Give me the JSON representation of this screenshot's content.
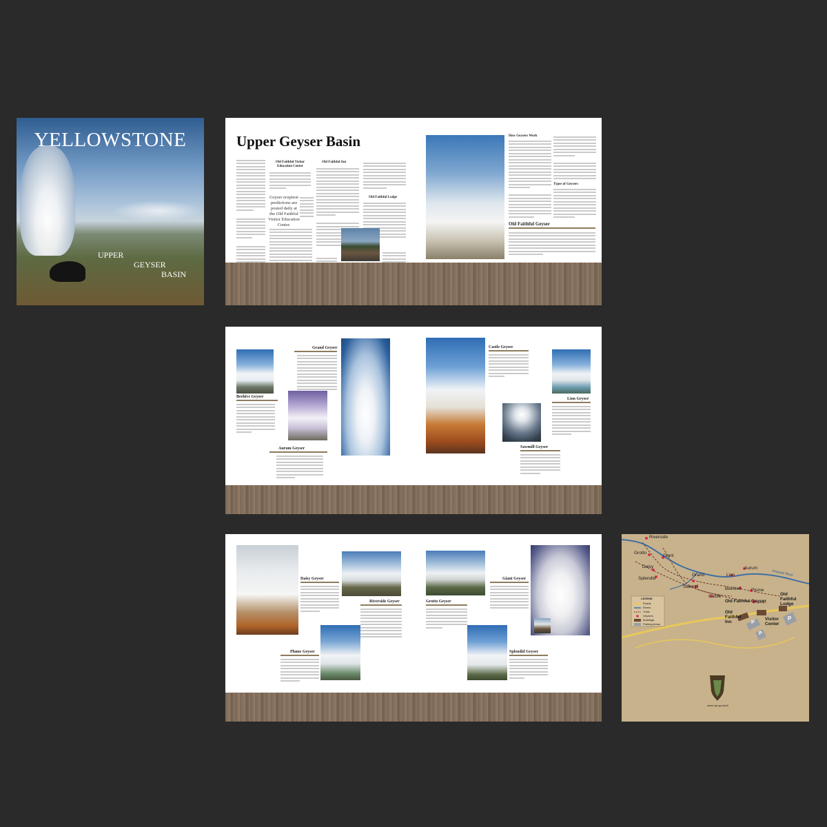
{
  "cover": {
    "title": "YELLOWSTONE",
    "subtitle_lines": [
      "UPPER",
      "GEYSER",
      "BASIN"
    ]
  },
  "page1": {
    "title": "Upper Geyser Basin",
    "headings": {
      "visitor_center": "Old Faithful Visitor Education Center",
      "inn": "Old Faithful Inn",
      "lodge": "Old Faithful Lodge",
      "how_geysers_work": "How Geysers Work",
      "types_of_geysers": "Types of Geysers",
      "old_faithful": "Old Faithful Geyser"
    },
    "pull_quote": "Geyser eruption predictions are posted daily at the Old Faithful Visitor Education Center."
  },
  "page2": {
    "geysers": {
      "grand": "Grand Geyser",
      "beehive": "Beehive Geyser",
      "aurum": "Aurum Geyser",
      "castle": "Castle Geyser",
      "lion": "Lion Geyser",
      "sawmill": "Sawmill Geyser"
    }
  },
  "page3": {
    "geysers": {
      "daisy": "Daisy Geyser",
      "riverside": "Riverside Geyser",
      "plume": "Plume Geyser",
      "grotto": "Grotto Geyser",
      "giant": "Giant Geyser",
      "splendid": "Splendid Geyser"
    }
  },
  "map": {
    "labels": {
      "riverside": "Riverside",
      "grotto": "Grotto",
      "giant": "Giant",
      "daisy": "Daisy",
      "splendid": "Splendid",
      "grand": "Grand",
      "sawmill": "Sawmill",
      "lion": "Lion",
      "aurum": "Aurum",
      "castle": "Castle",
      "beehive": "Beehive",
      "plume": "Plume",
      "old_faithful_geyser": "Old Faithful Geyser",
      "old_faithful_lodge": "Old Faithful Lodge",
      "old_faithful_inn": "Old Faithful Inn",
      "visitor_center": "Visitor Center",
      "river": "Firehole River",
      "parking": "P",
      "url": "www.nps.gov/yell"
    },
    "legend": {
      "title": "LEGEND",
      "items": [
        "Roads",
        "Rivers",
        "Trails",
        "Geysers",
        "Buildings",
        "Parking Areas"
      ]
    },
    "colors": {
      "background": "#c8b28c",
      "river": "#3f6fa3",
      "road": "#e8c85a",
      "geyser": "#d8324a"
    }
  },
  "colors": {
    "page_background": "#2a2a2a",
    "heading_underline": "#8c7a5b"
  }
}
